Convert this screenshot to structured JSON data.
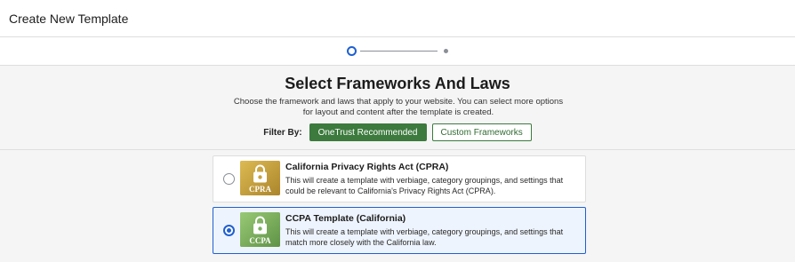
{
  "header": {
    "title": "Create New Template"
  },
  "stepper": {
    "current_step": 1,
    "total_steps": 2
  },
  "intro": {
    "title": "Select Frameworks And Laws",
    "description": "Choose the framework and laws that apply to your website. You can select more options for layout and content after the template is created.",
    "filter_label": "Filter By:",
    "filters": [
      {
        "label": "OneTrust Recommended",
        "active": true
      },
      {
        "label": "Custom Frameworks",
        "active": false
      }
    ]
  },
  "templates": [
    {
      "title": "California Privacy Rights Act (CPRA)",
      "description": "This will create a template with verbiage, category groupings, and settings that could be relevant to California's Privacy Rights Act (CPRA).",
      "logo_text": "CPRA",
      "logo_color": "#c9a23a",
      "selected": false
    },
    {
      "title": "CCPA Template (California)",
      "description": "This will create a template with verbiage, category groupings, and settings that match more closely with the California law.",
      "logo_text": "CCPA",
      "logo_color": "#7bb05c",
      "selected": true
    }
  ],
  "colors": {
    "accent": "#1f5fd1",
    "primary_green": "#3c7a3d"
  }
}
